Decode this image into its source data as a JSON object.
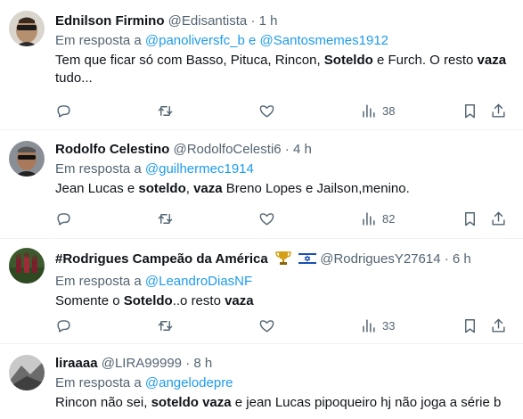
{
  "tweets": [
    {
      "name": "Ednilson Firmino",
      "handle": "@Edisantista",
      "sep": "·",
      "time": "1 h",
      "reply_prefix": "Em resposta a",
      "mentions": [
        "@panoliversfc_b",
        "@Santosmemes1912"
      ],
      "mention_joiner": "e",
      "text_parts": [
        "Tem que ficar só com Basso, Pituca, Rincon, ",
        "Soteldo",
        " e Furch. O resto ",
        "vaza",
        " tudo..."
      ],
      "views": "38"
    },
    {
      "name": "Rodolfo Celestino",
      "handle": "@RodolfoCelesti6",
      "sep": "·",
      "time": "4 h",
      "reply_prefix": "Em resposta a",
      "mentions": [
        "@guilhermec1914"
      ],
      "text_parts": [
        "Jean Lucas e ",
        "soteldo",
        ", ",
        "vaza",
        " Breno Lopes e Jailson,menino."
      ],
      "views": "82"
    },
    {
      "name": "#Rodrigues Campeão da América",
      "handle": "@RodriguesY27614",
      "sep": "·",
      "time": "6 h",
      "reply_prefix": "Em resposta a",
      "mentions": [
        "@LeandroDiasNF"
      ],
      "text_parts": [
        "Somente o ",
        "Soteldo",
        "..o resto ",
        "vaza"
      ],
      "views": "33"
    },
    {
      "name": "liraaaa",
      "handle": "@LIRA99999",
      "sep": "·",
      "time": "8 h",
      "reply_prefix": "Em resposta a",
      "mentions": [
        "@angelodepre"
      ],
      "text_parts": [
        "Rincon não sei, ",
        "soteldo vaza",
        " e jean Lucas pipoqueiro hj não joga a série b"
      ]
    }
  ],
  "icons": [
    "reply-icon",
    "retweet-icon",
    "like-icon",
    "views-icon",
    "bookmark-icon",
    "share-icon"
  ],
  "colors": {
    "link": "#1d9bf0",
    "secondary": "#536471",
    "text": "#0f1419"
  }
}
